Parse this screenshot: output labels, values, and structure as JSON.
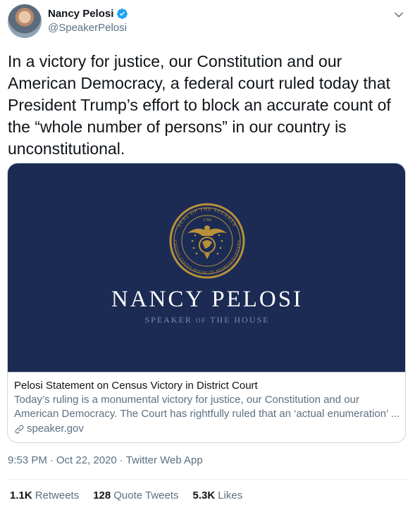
{
  "author": {
    "display_name": "Nancy Pelosi",
    "handle": "@SpeakerPelosi",
    "verified": true,
    "avatar": "profile-photo",
    "menu_icon": "chevron-down-icon"
  },
  "tweet": {
    "text": "In a victory for justice, our Constitution and our\nAmerican Democracy, a federal court ruled today that\nPresident Trump’s effort to block an accurate count of\nthe “whole number of persons” in our country is\nunconstitutional."
  },
  "card": {
    "image": {
      "seal_top": "SEAL OF THE SPEAKER",
      "seal_year": "1789",
      "seal_bottom": "UNITED STATES HOUSE OF REPRESENTATIVES",
      "name": "NANCY  PELOSI",
      "subtitle_a": "SPEAKER",
      "subtitle_of": "OF",
      "subtitle_b": "THE HOUSE"
    },
    "title": "Pelosi Statement on Census Victory in District Court",
    "description_line1": "Today’s ruling is a monumental victory for justice, our Constitution and our",
    "description_line2": "American Democracy. The Court has rightfully ruled that an ‘actual enumeration’ ...",
    "domain": "speaker.gov",
    "link_icon": "link-icon"
  },
  "meta": {
    "time": "9:53 PM",
    "separator": "·",
    "date": "Oct 22, 2020",
    "client": "Twitter Web App"
  },
  "stats": {
    "retweets_count": "1.1K",
    "retweets_label": "Retweets",
    "quotes_count": "128",
    "quotes_label": "Quote Tweets",
    "likes_count": "5.3K",
    "likes_label": "Likes"
  },
  "colors": {
    "card_bg": "#1c2b54",
    "seal_gold": "#b8913a",
    "secondary_text": "#5b7083",
    "verified_blue": "#1da1f2"
  }
}
